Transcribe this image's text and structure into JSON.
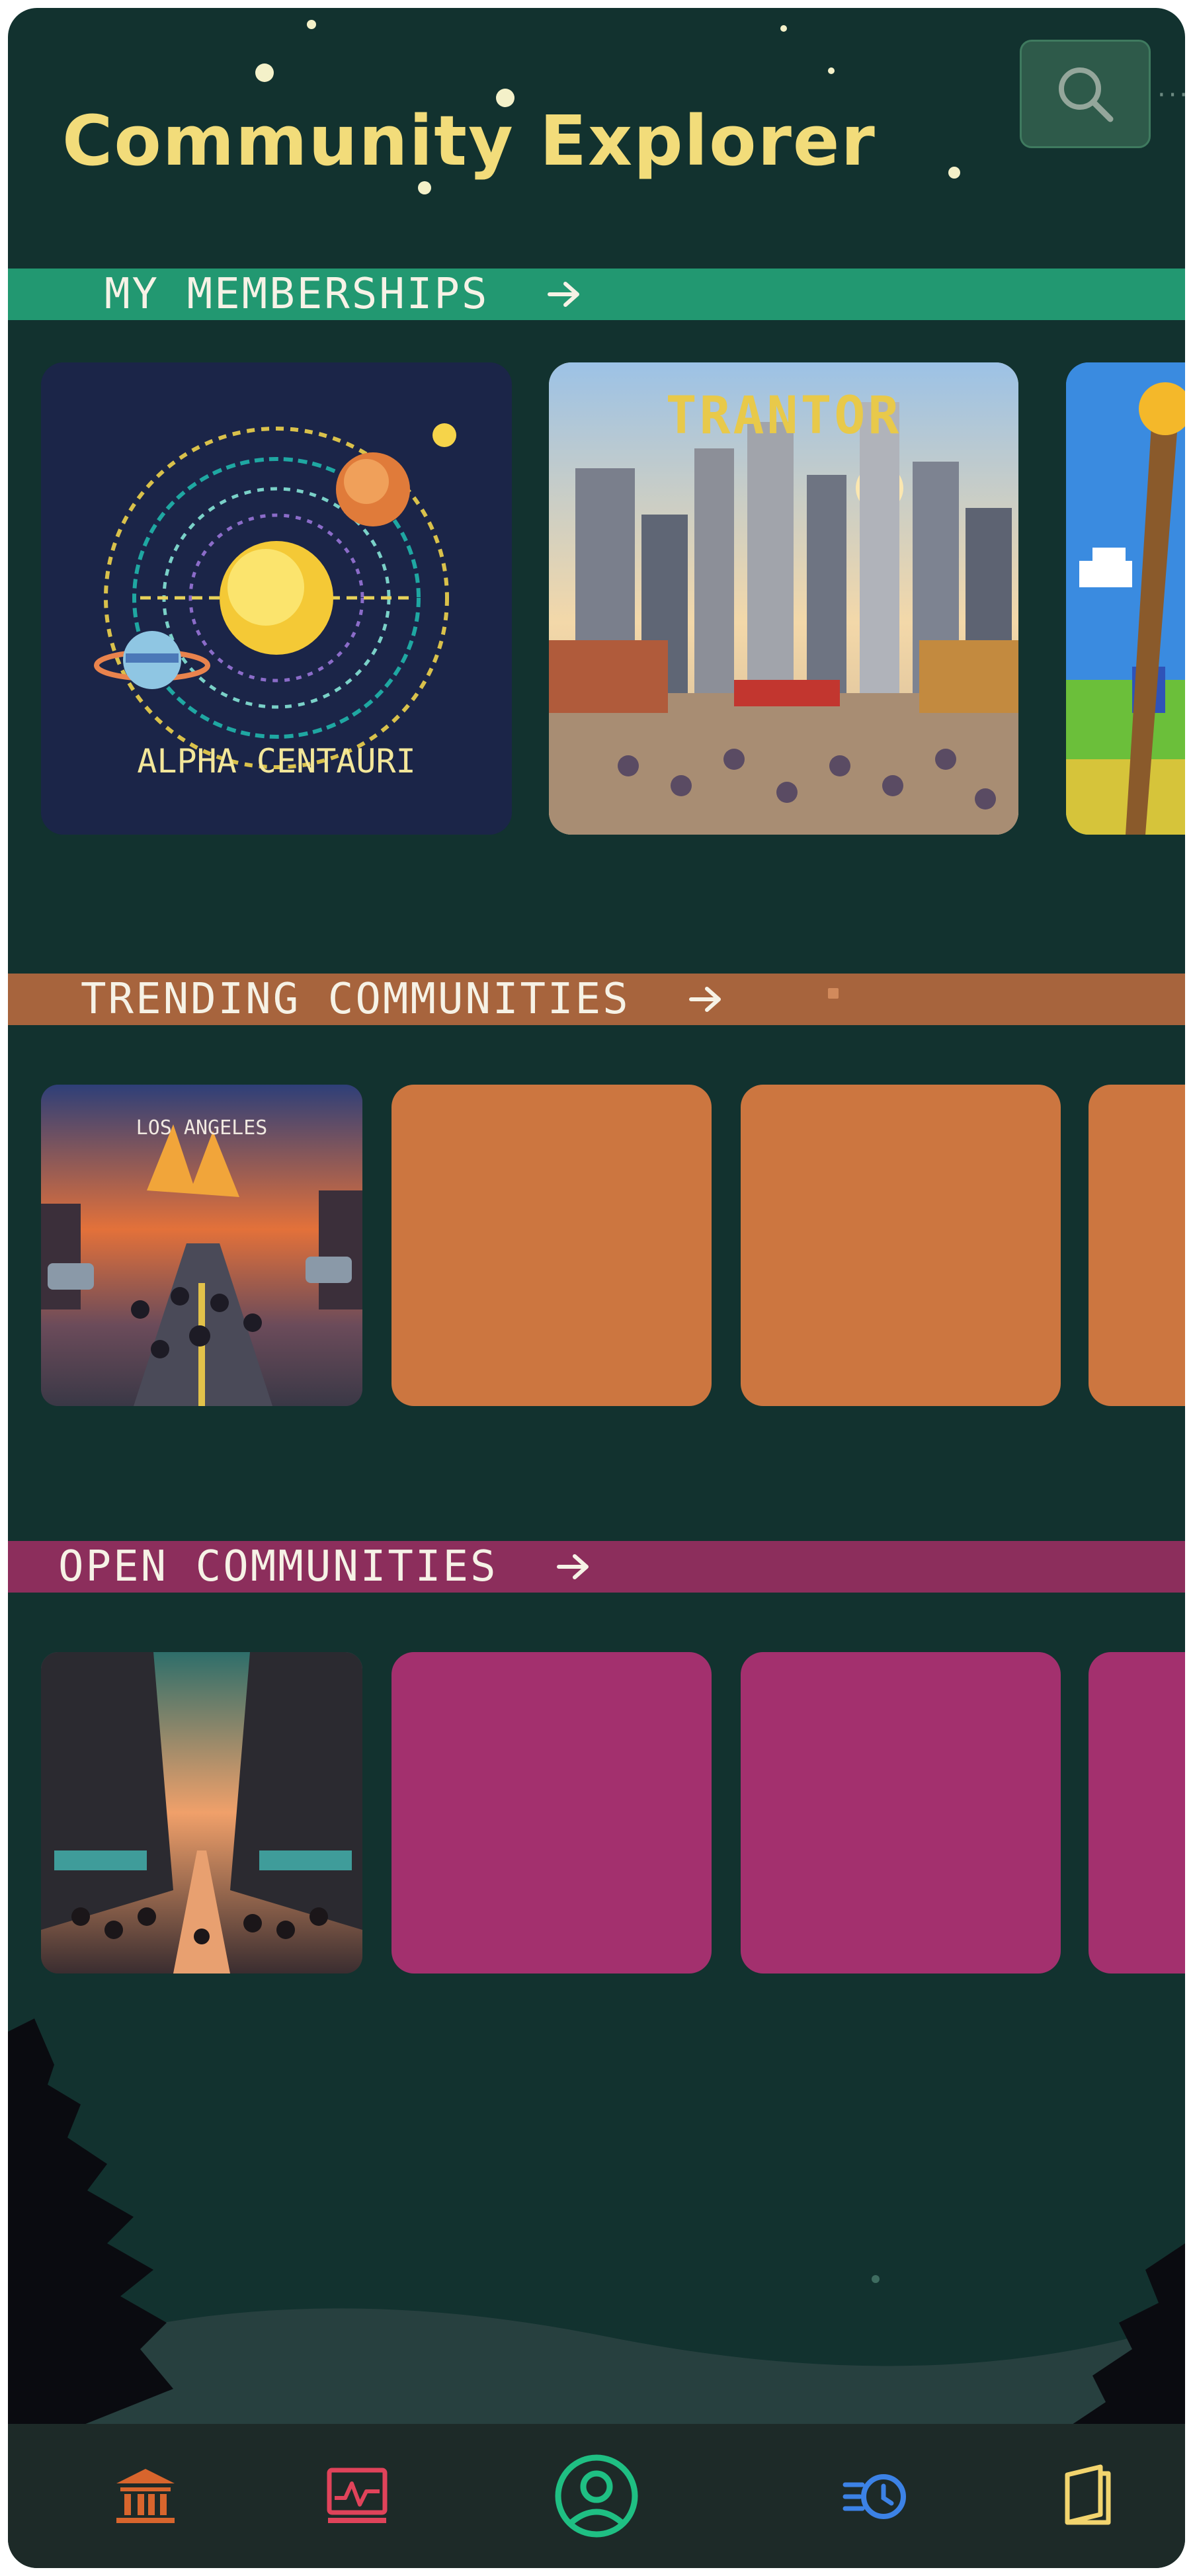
{
  "header": {
    "title": "Community Explorer",
    "search_icon": "search-icon",
    "more_icon": "more-dots-icon"
  },
  "sections": {
    "memberships": {
      "label": "MY MEMBERSHIPS",
      "color": "#229871",
      "cards": [
        {
          "name": "ALPHA CENTAURI",
          "art": "solar-system"
        },
        {
          "name": "TRANTOR",
          "art": "city"
        },
        {
          "name": "",
          "art": "landscape"
        }
      ]
    },
    "trending": {
      "label": "TRENDING COMMUNITIES",
      "color": "#a7643d",
      "placeholder_color": "#cc7640",
      "cards": [
        {
          "name": "LOS ANGELES",
          "art": "burning-city"
        }
      ]
    },
    "open": {
      "label": "OPEN COMMUNITIES",
      "color": "#8c2e5c",
      "placeholder_color": "#a3306e",
      "cards": [
        {
          "name": "",
          "art": "city-street"
        }
      ]
    }
  },
  "nav": {
    "items": [
      {
        "icon": "institution-icon",
        "color": "#d8652d"
      },
      {
        "icon": "activity-chart-icon",
        "color": "#e0435a"
      },
      {
        "icon": "profile-icon",
        "color": "#1fbf83",
        "active": true
      },
      {
        "icon": "history-icon",
        "color": "#3c82e6"
      },
      {
        "icon": "book-icon",
        "color": "#f2d46e"
      }
    ]
  }
}
